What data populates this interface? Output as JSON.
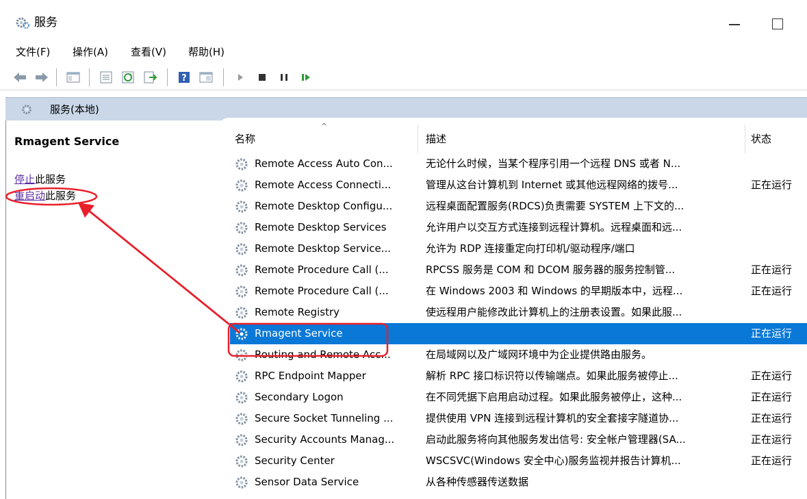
{
  "window": {
    "title": "服务"
  },
  "menu": [
    "文件(F)",
    "操作(A)",
    "查看(V)",
    "帮助(H)"
  ],
  "pane_header": "服务(本地)",
  "left": {
    "service_title": "Rmagent Service",
    "stop_link": "停止",
    "stop_rest": "此服务",
    "restart_link": "重启动",
    "restart_rest": "此服务"
  },
  "columns": {
    "name": "名称",
    "desc": "描述",
    "status": "状态"
  },
  "rows": [
    {
      "name": "Remote Access Auto Con...",
      "desc": "无论什么时候，当某个程序引用一个远程 DNS 或者 N...",
      "status": ""
    },
    {
      "name": "Remote Access Connecti...",
      "desc": "管理从这台计算机到 Internet 或其他远程网络的拨号...",
      "status": "正在运行"
    },
    {
      "name": "Remote Desktop Configu...",
      "desc": "远程桌面配置服务(RDCS)负责需要 SYSTEM 上下文的...",
      "status": ""
    },
    {
      "name": "Remote Desktop Services",
      "desc": "允许用户以交互方式连接到远程计算机。远程桌面和远...",
      "status": ""
    },
    {
      "name": "Remote Desktop Service...",
      "desc": "允许为 RDP 连接重定向打印机/驱动程序/端口",
      "status": ""
    },
    {
      "name": "Remote Procedure Call (...",
      "desc": "RPCSS 服务是 COM 和 DCOM 服务器的服务控制管...",
      "status": "正在运行"
    },
    {
      "name": "Remote Procedure Call (...",
      "desc": "在 Windows 2003 和 Windows 的早期版本中，远程...",
      "status": "正在运行"
    },
    {
      "name": "Remote Registry",
      "desc": "使远程用户能修改此计算机上的注册表设置。如果此服...",
      "status": ""
    },
    {
      "name": "Rmagent Service",
      "desc": "",
      "status": "正在运行",
      "selected": true
    },
    {
      "name": "Routing and Remote Acc...",
      "desc": "在局域网以及广域网环境中为企业提供路由服务。",
      "status": ""
    },
    {
      "name": "RPC Endpoint Mapper",
      "desc": "解析 RPC 接口标识符以传输端点。如果此服务被停止...",
      "status": "正在运行"
    },
    {
      "name": "Secondary Logon",
      "desc": "在不同凭据下启用启动过程。如果此服务被停止，这种...",
      "status": "正在运行"
    },
    {
      "name": "Secure Socket Tunneling ...",
      "desc": "提供使用 VPN 连接到远程计算机的安全套接字隧道协...",
      "status": "正在运行"
    },
    {
      "name": "Security Accounts Manag...",
      "desc": "启动此服务将向其他服务发出信号: 安全帐户管理器(SA...",
      "status": "正在运行"
    },
    {
      "name": "Security Center",
      "desc": "WSCSVC(Windows 安全中心)服务监视并报告计算机...",
      "status": "正在运行"
    },
    {
      "name": "Sensor Data Service",
      "desc": "从各种传感器传送数据",
      "status": ""
    }
  ],
  "colors": {
    "selection": "#0a78d7",
    "pane_header": "#c9d7e8",
    "annotation": "#e8202a",
    "link": "#5a2ca0"
  },
  "icons": {
    "toolbar": [
      "back-arrow-icon",
      "forward-arrow-icon",
      "console-tree-icon",
      "properties-icon",
      "refresh-icon",
      "export-list-icon",
      "help-icon",
      "view-icon",
      "start-service-icon",
      "stop-service-icon",
      "pause-service-icon",
      "resume-service-icon"
    ],
    "service": "gear-icon"
  }
}
